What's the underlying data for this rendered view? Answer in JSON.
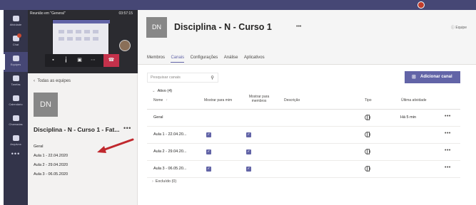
{
  "colors": {
    "brand": "#6264a7",
    "rail": "#33344a",
    "topbar": "#464775",
    "hangup": "#c4314b",
    "arrow": "#c0282d"
  },
  "rail": {
    "items": [
      {
        "label": "Atividade",
        "icon": "bell-icon"
      },
      {
        "label": "Chat",
        "icon": "chat-icon"
      },
      {
        "label": "Equipes",
        "icon": "teams-icon"
      },
      {
        "label": "Tarefas",
        "icon": "assignments-icon"
      },
      {
        "label": "Calendário",
        "icon": "calendar-icon"
      },
      {
        "label": "Chamadas",
        "icon": "phone-icon"
      },
      {
        "label": "Arquivos",
        "icon": "files-icon"
      }
    ],
    "more": "•••"
  },
  "meeting": {
    "title": "Reunião em \"General\"",
    "time": "03:57:15",
    "controls": [
      "camera-icon",
      "mic-icon",
      "share-icon",
      "more-icon",
      "hangup-icon"
    ]
  },
  "left": {
    "back": "Todas as equipes",
    "avatar": "DN",
    "team_name": "Disciplina - N - Curso 1 - Fat...",
    "more": "•••",
    "channels": [
      "Geral",
      "Aula 1 - 22.04.2020",
      "Aula 2 - 29.04.2020",
      "Aula 3 - 06.05.2020"
    ]
  },
  "header": {
    "avatar": "DN",
    "title": "Disciplina - N - Curso 1",
    "more": "•••",
    "team_button": "Equipe",
    "tabs": [
      "Membros",
      "Canais",
      "Configurações",
      "Análise",
      "Aplicativos"
    ],
    "active_tab": "Canais"
  },
  "toolbar": {
    "search_placeholder": "Pesquisar canais",
    "add_channel": "Adicionar canal"
  },
  "table": {
    "active_group": "Ativo (4)",
    "columns": {
      "name": "Nome",
      "show_me": "Mostrar para mim",
      "show_members": "Mostrar para membros",
      "description": "Descrição",
      "type": "Tipo",
      "last_activity": "Última atividade"
    },
    "rows": [
      {
        "name": "Geral",
        "show_me": false,
        "show_members": false,
        "last_activity": "Há 5 min"
      },
      {
        "name": "Aula 1 - 22.04.20...",
        "show_me": true,
        "show_members": true,
        "last_activity": ""
      },
      {
        "name": "Aula 2 - 29.04.20...",
        "show_me": true,
        "show_members": true,
        "last_activity": ""
      },
      {
        "name": "Aula 3 - 06.05.20...",
        "show_me": true,
        "show_members": true,
        "last_activity": ""
      }
    ],
    "excluded_group": "Excluído (0)",
    "row_more": "•••"
  }
}
